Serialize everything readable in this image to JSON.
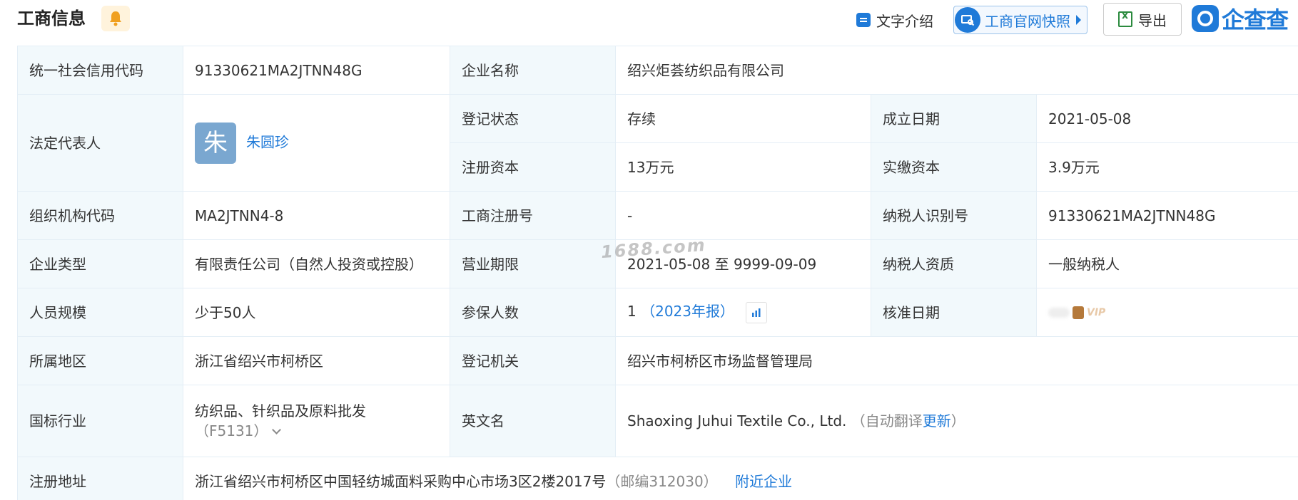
{
  "header": {
    "title": "工商信息",
    "text_intro": "文字介绍",
    "snapshot": "工商官网快照",
    "export": "导出",
    "brand": "企查查"
  },
  "watermark": "1688.com",
  "fields": {
    "credit_code": {
      "label": "统一社会信用代码",
      "value": "91330621MA2JTNN48G"
    },
    "company_name": {
      "label": "企业名称",
      "value": "绍兴炬荟纺织品有限公司"
    },
    "legal_rep": {
      "label": "法定代表人",
      "avatar_char": "朱",
      "name": "朱圆珍"
    },
    "reg_status": {
      "label": "登记状态",
      "value": "存续"
    },
    "found_date": {
      "label": "成立日期",
      "value": "2021-05-08"
    },
    "reg_capital": {
      "label": "注册资本",
      "value": "13万元"
    },
    "paid_capital": {
      "label": "实缴资本",
      "value": "3.9万元"
    },
    "org_code": {
      "label": "组织机构代码",
      "value": "MA2JTNN4-8"
    },
    "reg_no": {
      "label": "工商注册号",
      "value": "-"
    },
    "taxpayer_id": {
      "label": "纳税人识别号",
      "value": "91330621MA2JTNN48G"
    },
    "company_type": {
      "label": "企业类型",
      "value": "有限责任公司（自然人投资或控股）"
    },
    "biz_term": {
      "label": "营业期限",
      "value": "2021-05-08 至 9999-09-09"
    },
    "taxpayer_qual": {
      "label": "纳税人资质",
      "value": "一般纳税人"
    },
    "staff_size": {
      "label": "人员规模",
      "value": "少于50人"
    },
    "insured": {
      "label": "参保人数",
      "value": "1",
      "report": "（2023年报）"
    },
    "approval_date": {
      "label": "核准日期",
      "vip_tag": "VIP"
    },
    "region": {
      "label": "所属地区",
      "value": "浙江省绍兴市柯桥区"
    },
    "reg_authority": {
      "label": "登记机关",
      "value": "绍兴市柯桥区市场监督管理局"
    },
    "industry": {
      "label": "国标行业",
      "value": "纺织品、针织品及原料批发",
      "code": "（F5131）"
    },
    "english_name": {
      "label": "英文名",
      "value": "Shaoxing Juhui Textile Co., Ltd.",
      "auto_pre": "（自动翻译",
      "auto_link": "更新",
      "auto_post": "）"
    },
    "address": {
      "label": "注册地址",
      "value": "浙江省绍兴市柯桥区中国轻纺城面料采购中心市场3区2楼2017号",
      "postcode": "（邮编312030）",
      "nearby": "附近企业"
    }
  },
  "colors": {
    "accent": "#1f7ad8",
    "label_bg": "#f2f9fc",
    "border": "#e4eef6"
  }
}
